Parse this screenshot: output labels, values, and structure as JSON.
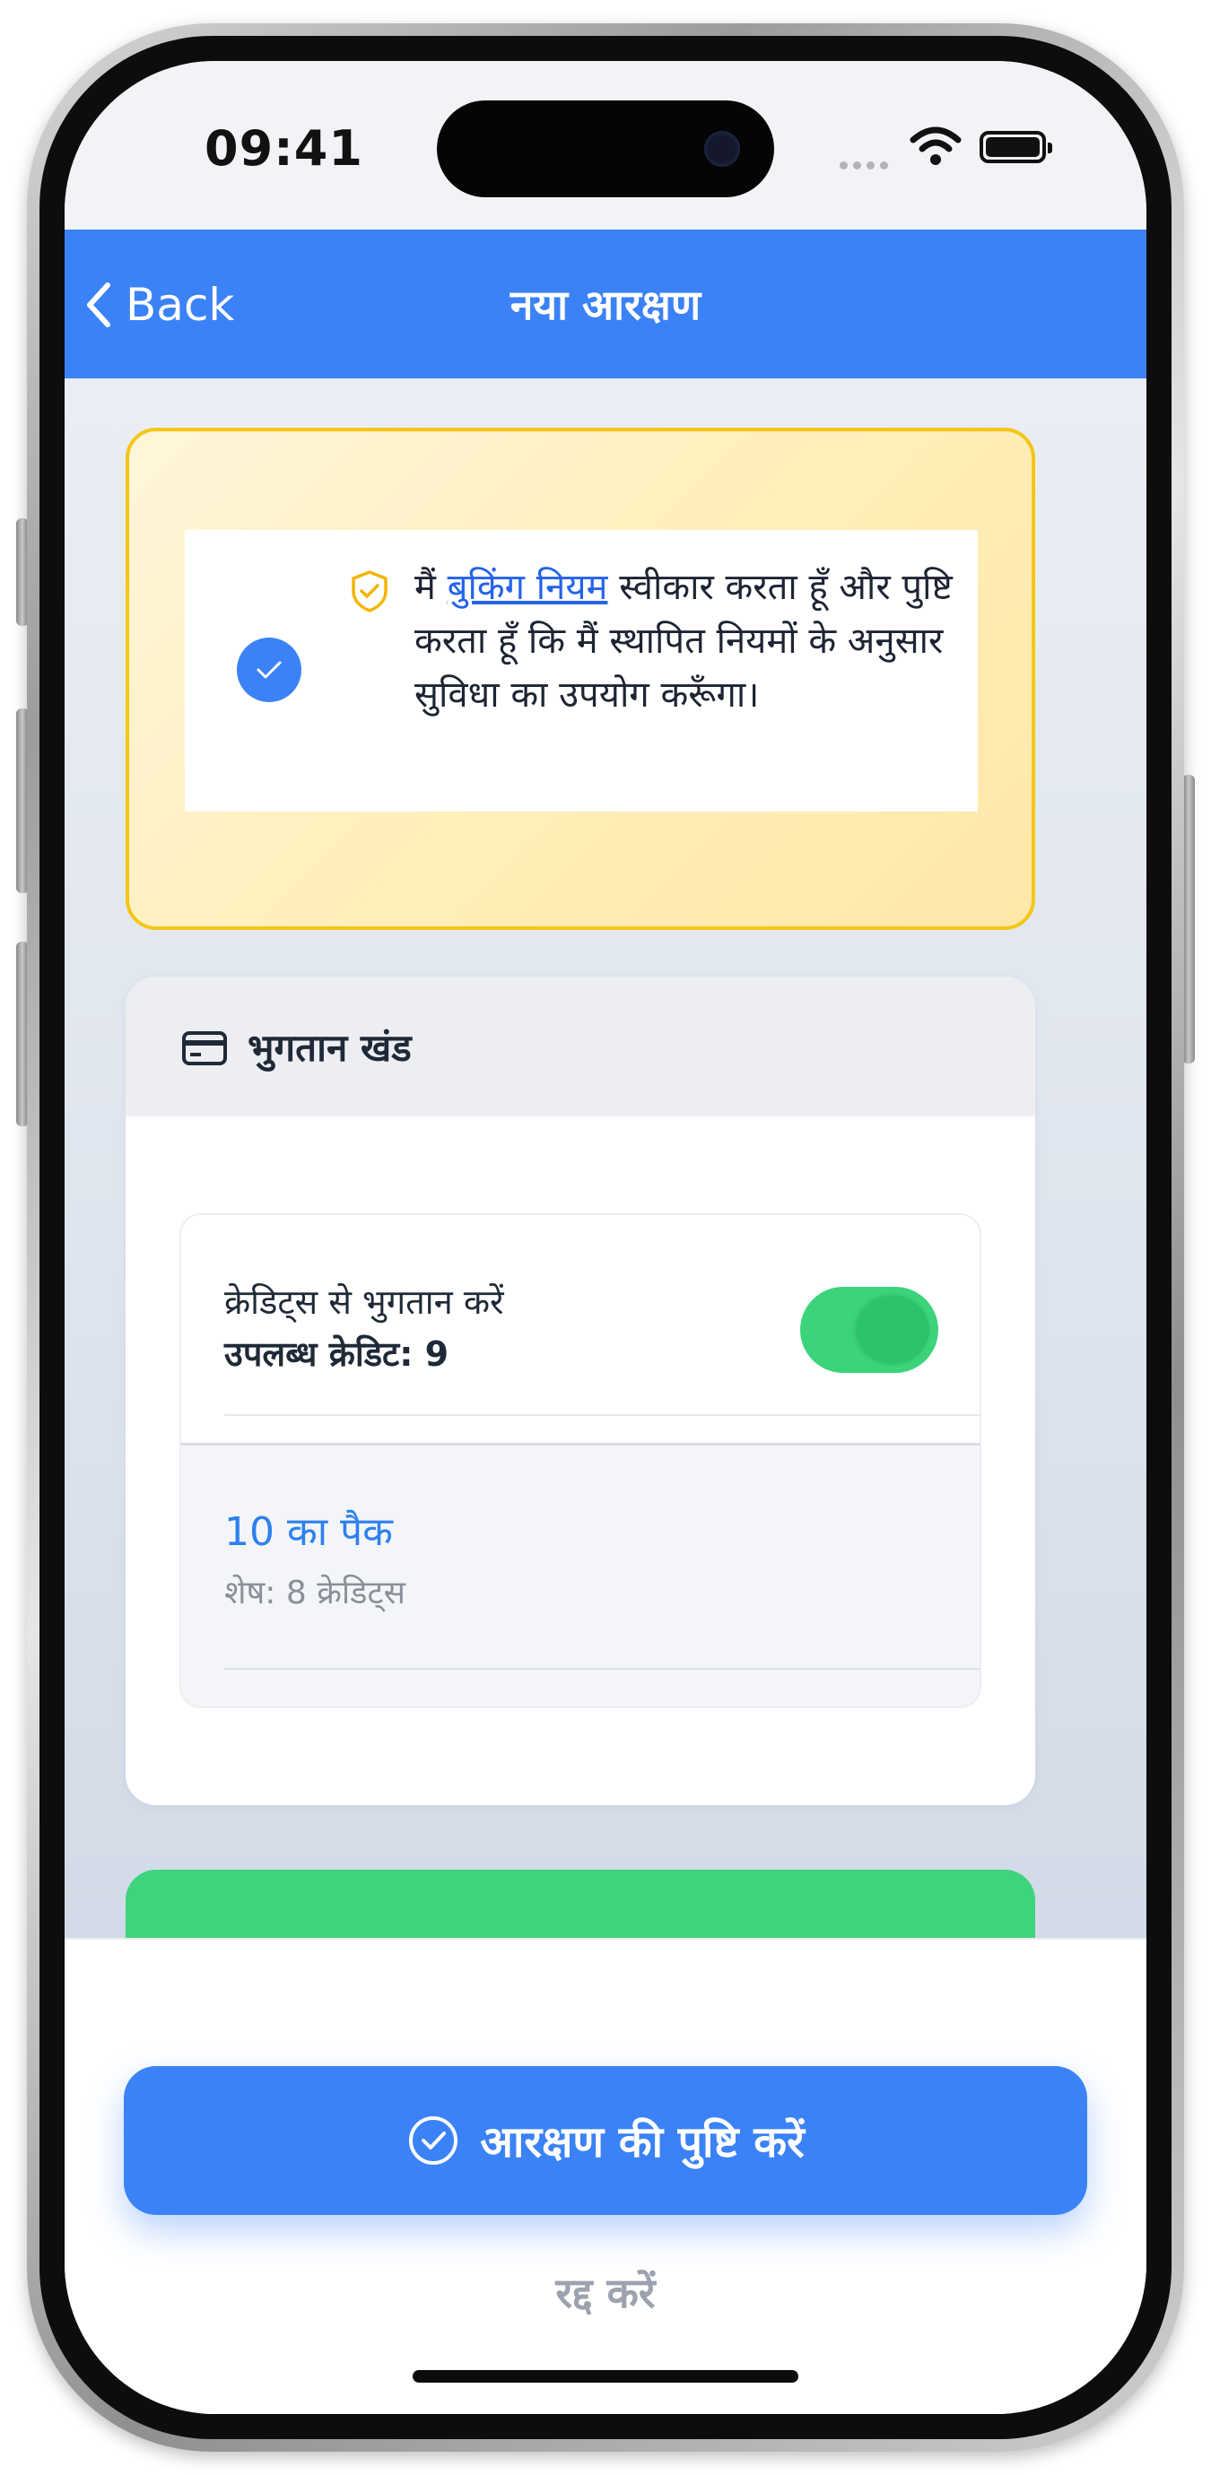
{
  "status_bar": {
    "time": "09:41"
  },
  "nav": {
    "back_label": "Back",
    "title": "नया आरक्षण"
  },
  "rules": {
    "checked": true,
    "text_prefix": "मैं ",
    "link": "बुकिंग नियम",
    "text_suffix": " स्वीकार करता हूँ और पुष्टि करता हूँ कि मैं स्थापित नियमों के अनुसार सुविधा का उपयोग करूँगा।"
  },
  "payment": {
    "title": "भुगतान खंड",
    "credits_label": "क्रेडिट्स से भुगतान करें",
    "available_credits": "उपलब्ध क्रेडिट: 9",
    "toggle_on": true,
    "pack_name": "10 का पैक",
    "pack_remaining": "शेष: 8 क्रेडिट्स"
  },
  "actions": {
    "confirm_label": "आरक्षण की पुष्टि करें",
    "cancel_label": "रद्द करें"
  },
  "colors": {
    "accent": "#3b82f6",
    "toggle_on": "#3bd47a",
    "rules_border": "#f5c518",
    "link": "#2563eb"
  }
}
